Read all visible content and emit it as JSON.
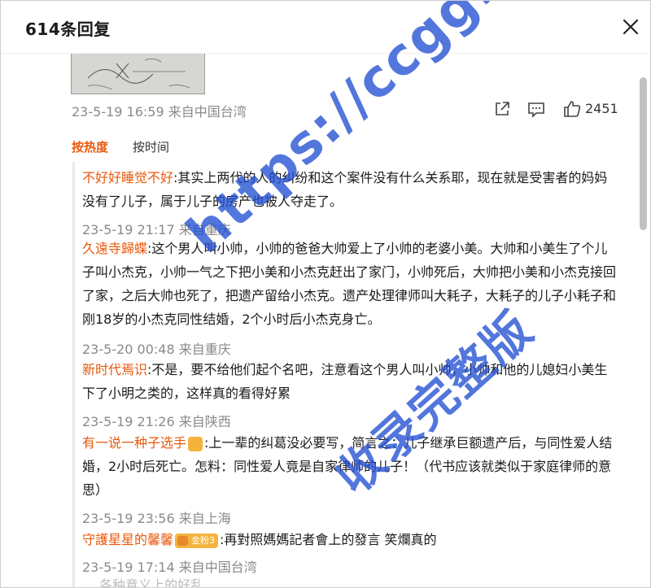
{
  "header": {
    "title": "614条回复",
    "close_icon": "close-icon"
  },
  "main_comment": {
    "meta": "23-5-19 16:59 来自中国台湾",
    "like_count": "2451",
    "icons": [
      "share-icon",
      "comment-icon",
      "like-icon"
    ]
  },
  "sort": {
    "hot": "按热度",
    "time": "按时间",
    "active_color": "#e8590c"
  },
  "replies": [
    {
      "user": "不好好睡觉不好",
      "text": ":其实上两代的人的纠纷和这个案件没有什么关系耶，现在就是受害者的妈妈没有了儿子，属于儿子的房产也被人夺走了。",
      "meta": "23-5-19 21:17 来自重庆"
    },
    {
      "user": "久遠寺歸蝶",
      "text": ":这个男人叫小帅，小帅的爸爸大帅爱上了小帅的老婆小美。大帅和小美生了个儿子叫小杰克，小帅一气之下把小美和小杰克赶出了家门，小帅死后，大帅把小美和小杰克接回了家，之后大帅也死了，把遗产留给小杰克。遗产处理律师叫大耗子，大耗子的儿子小耗子和刚18岁的小杰克同性结婚，2个小时后小杰克身亡。",
      "meta": "23-5-20 00:48 来自重庆"
    },
    {
      "user": "新时代焉识",
      "text": ":不是，要不给他们起个名吧，注意看这个男人叫小帅，小帅和他的儿媳妇小美生下了小明之类的，这样真的看得好累",
      "meta": "23-5-19 21:26 来自陕西"
    },
    {
      "user": "有一说一种子选手",
      "badge": "crown",
      "text": ":上一辈的纠葛没必要写，简言之：儿子继承巨额遗产后，与同性爱人结婚，2小时后死亡。怎料：同性爱人竟是自家律师的儿子！（代书应该就类似于家庭律师的意思）",
      "meta": "23-5-19 23:56 来自上海"
    },
    {
      "user": "守護星星的馨馨",
      "badge_label": "金粉3",
      "text": ":再對照媽媽記者會上的發言 笑爛真的",
      "meta": "23-5-19 17:14 来自中国台湾"
    }
  ],
  "cut_row_text": "…  各种意义上的好乱",
  "watermark": {
    "line1": "https://ccgg.me",
    "line2": "收录完整版",
    "color": "#2350d2"
  }
}
